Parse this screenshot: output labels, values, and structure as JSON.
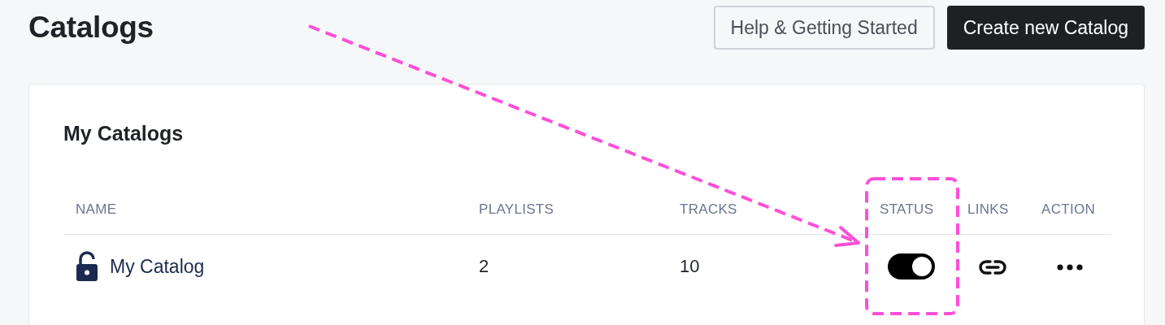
{
  "page": {
    "title": "Catalogs"
  },
  "buttons": [
    {
      "label": "Help & Getting Started",
      "kind": "secondary"
    },
    {
      "label": "Create new Catalog",
      "kind": "primary"
    }
  ],
  "card": {
    "title": "My Catalogs",
    "table": {
      "columns": [
        "NAME",
        "PLAYLISTS",
        "TRACKS",
        "STATUS",
        "LINKS",
        "ACTION"
      ],
      "rows": [
        {
          "name": "My Catalog",
          "locked": false,
          "playlists": "2",
          "tracks": "10",
          "status_on": true
        }
      ]
    }
  }
}
